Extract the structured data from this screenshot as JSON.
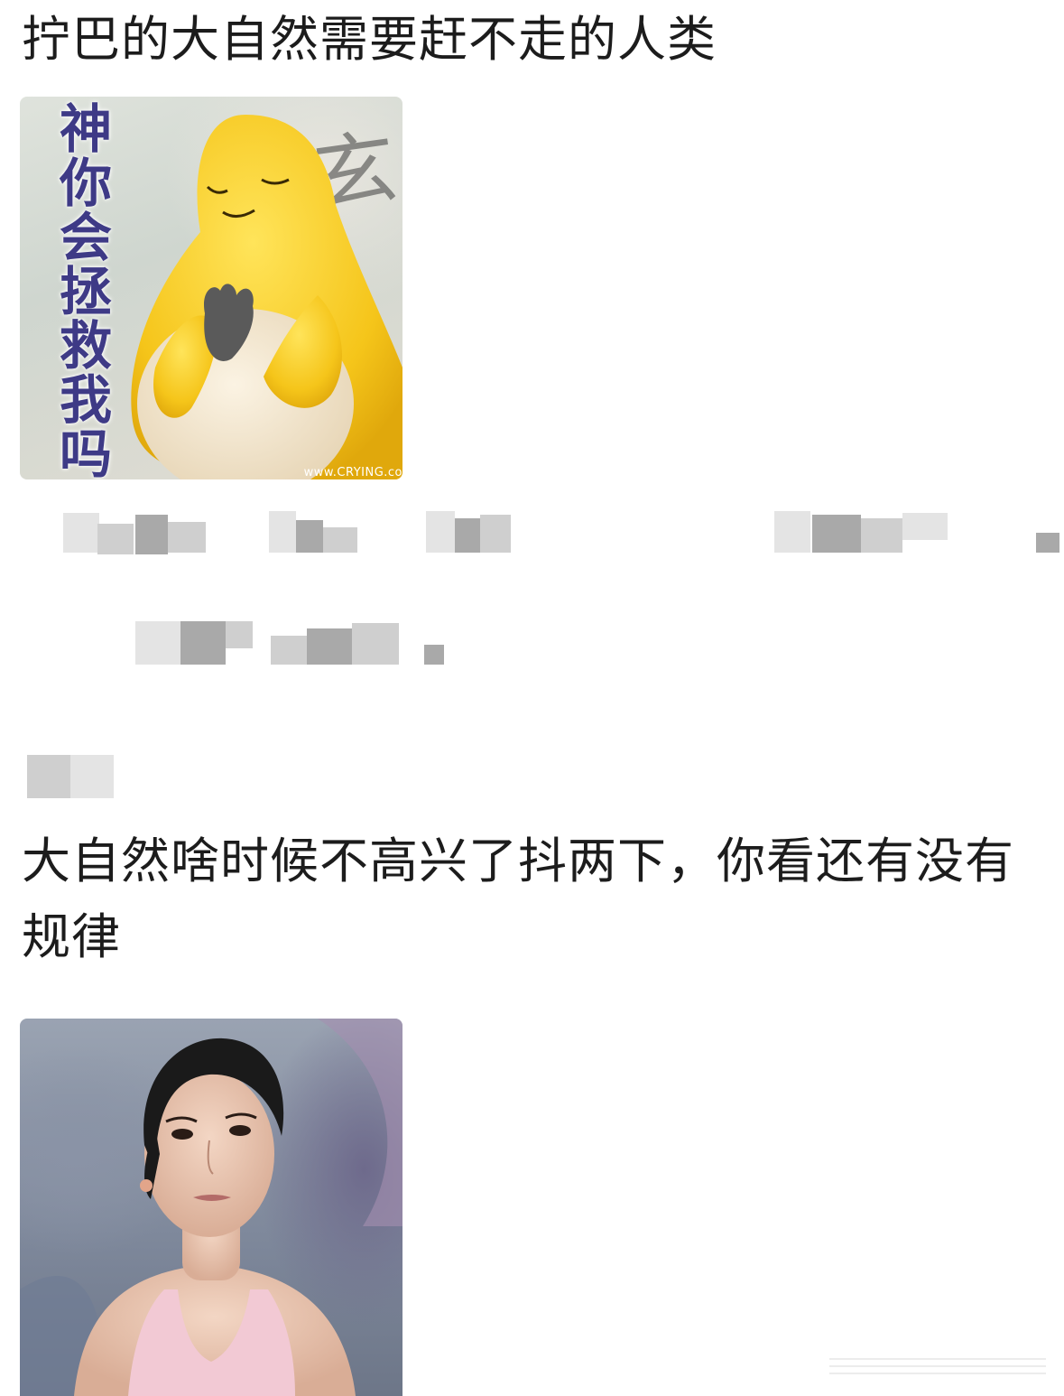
{
  "post": {
    "title_line": "拧巴的大自然需要赶不走的人类",
    "reply_text": "大自然啥时候不高兴了抖两下，你看还有没有规律"
  },
  "meme1": {
    "caption_chars": [
      "神",
      "你",
      "会",
      "拯",
      "救",
      "我",
      "吗"
    ],
    "watermark": "www.CRYING.co",
    "brush_char": "玄",
    "colors": {
      "caption": "#3e3a86",
      "creature": "#f7cc1f",
      "belly": "#f1e6cf"
    }
  },
  "meme2": {
    "colors": {
      "top": "#f2c9d4",
      "hair": "#1a1a1a"
    }
  }
}
